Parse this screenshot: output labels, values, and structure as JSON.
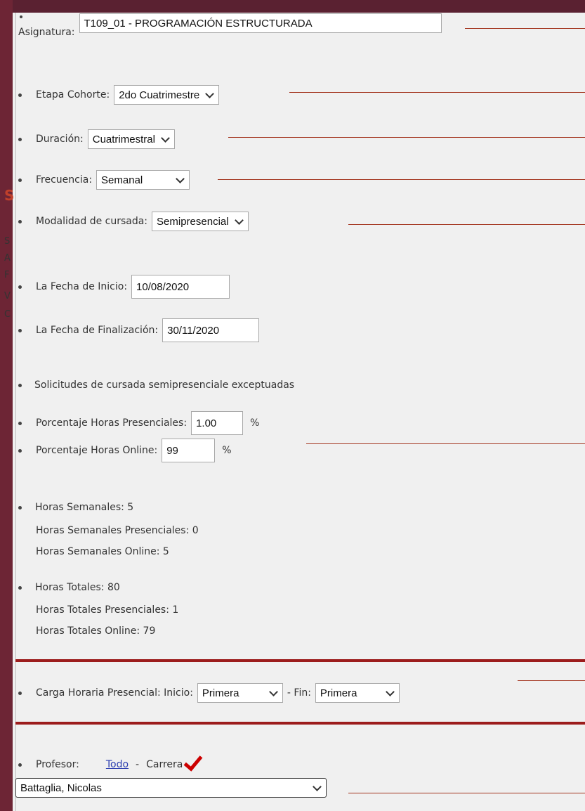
{
  "form": {
    "asignatura": {
      "label": "Asignatura:",
      "value": "T109_01 - PROGRAMACIÓN ESTRUCTURADA"
    },
    "etapa": {
      "label": "Etapa Cohorte:",
      "value": "2do Cuatrimestre"
    },
    "duracion": {
      "label": "Duración:",
      "value": "Cuatrimestral"
    },
    "frecuencia": {
      "label": "Frecuencia:",
      "value": "Semanal"
    },
    "modalidad": {
      "label": "Modalidad de cursada:",
      "value": "Semipresencial"
    },
    "fecha_inicio": {
      "label": "La Fecha de Inicio:",
      "value": "10/08/2020"
    },
    "fecha_fin": {
      "label": "La Fecha de Finalización:",
      "value": "30/11/2020"
    },
    "solicitudes": "Solicitudes de cursada semipresenciale exceptuadas",
    "pct_presencial": {
      "label": "Porcentaje Horas Presenciales:",
      "value": "1.00",
      "unit": "%"
    },
    "pct_online": {
      "label": "Porcentaje Horas Online:",
      "value": "99",
      "unit": "%"
    },
    "horas_semanales": {
      "total": "Horas Semanales:  5",
      "presenciales": "Horas Semanales Presenciales:  0",
      "online": "Horas Semanales Online:  5"
    },
    "horas_totales": {
      "total": "Horas Totales:  80",
      "presenciales": "Horas Totales Presenciales:  1",
      "online": "Horas Totales Online:  79"
    },
    "carga": {
      "label": "Carga Horaria Presencial: Inicio:",
      "inicio": "Primera",
      "fin_label": "- Fin:",
      "fin": "Primera"
    },
    "profesor": {
      "label": "Profesor:",
      "todo_link": "Todo",
      "separator": "-",
      "carrera": "Carrera",
      "value": "Battaglia, Nicolas"
    }
  },
  "colors": {
    "accent_red": "#9c1c1c",
    "annotation_line": "#a3341e",
    "frame": "#6d2535"
  },
  "icons": [
    "check-mark-icon",
    "chevron-down-icon"
  ]
}
